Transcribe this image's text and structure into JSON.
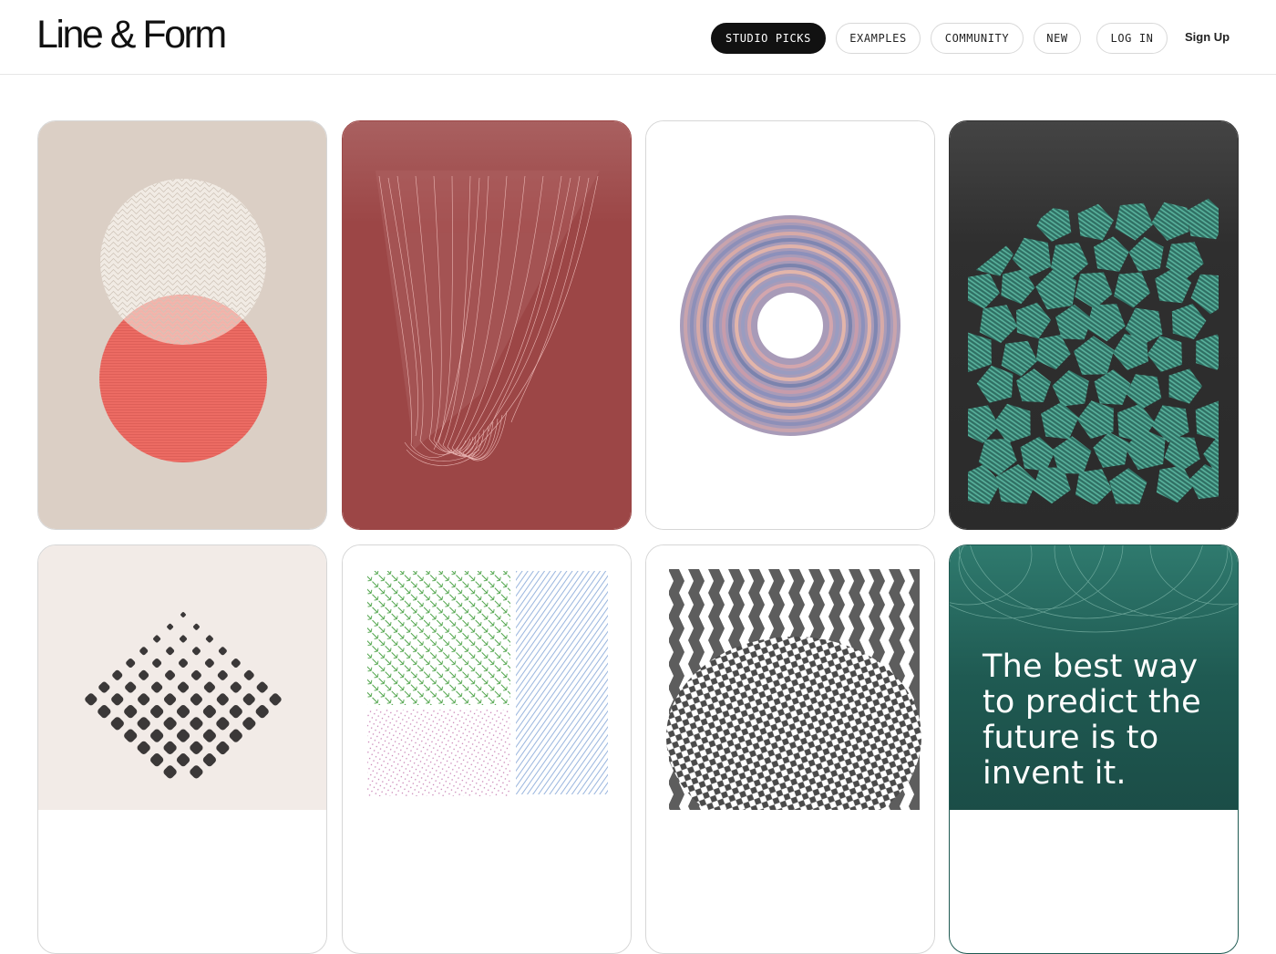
{
  "brand": {
    "name": "Line & Form"
  },
  "nav": {
    "items": [
      {
        "label": "STUDIO PICKS",
        "active": true
      },
      {
        "label": "EXAMPLES",
        "active": false
      },
      {
        "label": "COMMUNITY",
        "active": false
      },
      {
        "label": "NEW",
        "active": false
      }
    ],
    "login_label": "LOG IN",
    "signup_label": "Sign Up"
  },
  "gallery": {
    "cards": [
      {
        "art": "overlapping-circles",
        "background": "#dbcfc5"
      },
      {
        "art": "draped-lines",
        "background": "#9c4646"
      },
      {
        "art": "moire-torus",
        "background": "#ffffff"
      },
      {
        "art": "hatched-pentagons",
        "background": "#333333"
      },
      {
        "art": "diamond-dots",
        "background": "#f2ebe7"
      },
      {
        "art": "hatched-panels",
        "background": "#ffffff"
      },
      {
        "art": "chevron-pattern",
        "background": "#ffffff"
      },
      {
        "art": "quote-card",
        "background": "#1f5a52",
        "quote": "The best way to predict the future is to invent it."
      }
    ]
  },
  "colors": {
    "accent_dark": "#111111",
    "coral": "#ec6b63",
    "teal": "#4f9f8d",
    "deep_teal": "#1f5a52"
  }
}
